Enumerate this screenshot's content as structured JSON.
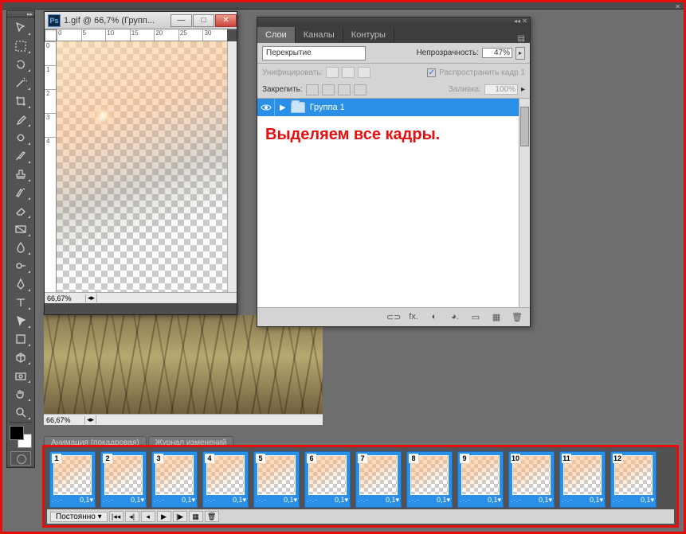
{
  "top_close": "✕",
  "docwin": {
    "title": "1.gif @ 66,7% (Групп...",
    "min": "—",
    "max": "□",
    "close": "✕",
    "ruler_h": [
      "0",
      "5",
      "10",
      "15",
      "20",
      "25",
      "30"
    ],
    "ruler_v": [
      "0",
      "1",
      "2",
      "3",
      "4"
    ],
    "zoom": "66,67%",
    "nav_icon": "◂▸"
  },
  "bg_status": {
    "zoom": "66,67%",
    "nav": "◂▸"
  },
  "midtabs": {
    "anim": "Анимация (покадровая)",
    "log": "Журнал изменений"
  },
  "panel": {
    "close": "◂◂ ✕",
    "tabs": {
      "layers": "Слои",
      "channels": "Каналы",
      "paths": "Контуры"
    },
    "menu": "▤",
    "blend_mode": "Перекрытие",
    "opacity_label": "Непрозрачность:",
    "opacity_val": "47%",
    "unify": "Унифицировать:",
    "propagate": "Распространить кадр 1",
    "lock_label": "Закрепить:",
    "fill_label": "Заливка:",
    "fill_val": "100%",
    "layer_name": "Группа 1",
    "annotation": "Выделяем все кадры.",
    "footer_icons": [
      "⊂⊃",
      "fx.",
      "◐",
      "◕.",
      "▭",
      "▦",
      "🗑"
    ]
  },
  "frames": [
    {
      "n": "1",
      "d": "0,1▾"
    },
    {
      "n": "2",
      "d": "0,1▾"
    },
    {
      "n": "3",
      "d": "0,1▾"
    },
    {
      "n": "4",
      "d": "0,1▾"
    },
    {
      "n": "5",
      "d": "0,1▾"
    },
    {
      "n": "6",
      "d": "0,1▾"
    },
    {
      "n": "7",
      "d": "0,1▾"
    },
    {
      "n": "8",
      "d": "0,1▾"
    },
    {
      "n": "9",
      "d": "0,1▾"
    },
    {
      "n": "10",
      "d": "0,1▾"
    },
    {
      "n": "11",
      "d": "0,1▾"
    },
    {
      "n": "12",
      "d": "0,1▾"
    }
  ],
  "anim_footer": {
    "loop": "Постоянно  ▾",
    "btns": [
      "|◂◂",
      "◂|",
      "◂",
      "▶",
      "|▶",
      "▦",
      "🗑"
    ]
  }
}
